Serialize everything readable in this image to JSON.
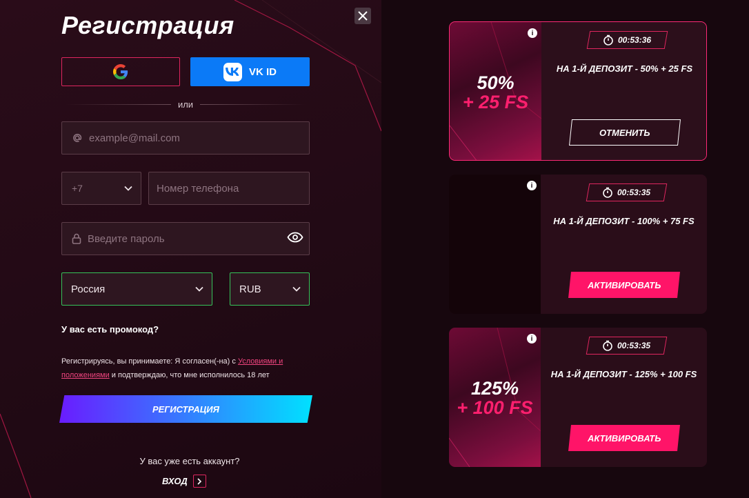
{
  "form": {
    "title": "Регистрация",
    "google_icon": "google-logo",
    "vk_label": "VK ID",
    "or_text": "или",
    "email_placeholder": "example@mail.com",
    "phone_code": "+7",
    "phone_placeholder": "Номер телефона",
    "password_placeholder": "Введите пароль",
    "country": "Россия",
    "currency": "RUB",
    "promo_text": "У вас есть промокод?",
    "terms_prefix": "Регистрируясь, вы принимаете: Я согласен(-на) с ",
    "terms_link": "Условиями и положениями",
    "terms_suffix": " и подтверждаю, что мне исполнилось 18 лет",
    "register_label": "РЕГИСТРАЦИЯ",
    "have_account": "У вас уже есть аккаунт?",
    "login_label": "ВХОД"
  },
  "bonuses": [
    {
      "percent": "50%",
      "extra": "+ 25 FS",
      "timer": "00:53:36",
      "title": "НА 1-Й ДЕПОЗИТ - 50% + 25 FS",
      "button": "ОТМЕНИТЬ",
      "active": true
    },
    {
      "percent": "",
      "extra": "",
      "timer": "00:53:35",
      "title": "НА 1-Й ДЕПОЗИТ - 100% + 75 FS",
      "button": "АКТИВИРОВАТЬ",
      "active": false
    },
    {
      "percent": "125%",
      "extra": "+ 100 FS",
      "timer": "00:53:35",
      "title": "НА 1-Й ДЕПОЗИТ - 125% + 100 FS",
      "button": "АКТИВИРОВАТЬ",
      "active": false
    }
  ],
  "colors": {
    "accent": "#ff1468",
    "vk_blue": "#0b7af7",
    "valid_green": "#36c45a"
  }
}
